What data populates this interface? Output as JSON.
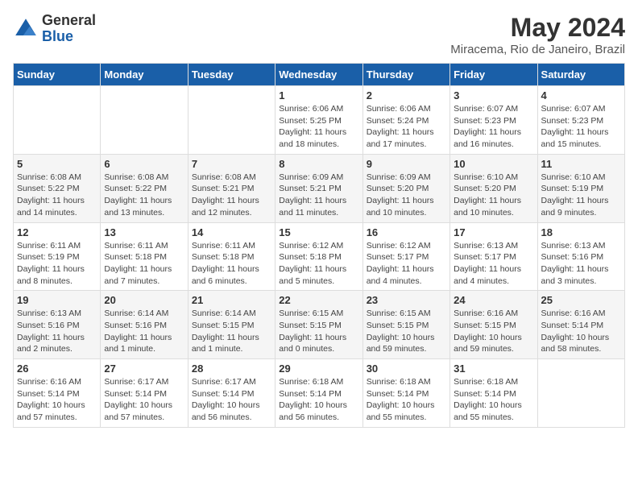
{
  "logo": {
    "general": "General",
    "blue": "Blue"
  },
  "title": {
    "month_year": "May 2024",
    "location": "Miracema, Rio de Janeiro, Brazil"
  },
  "days_of_week": [
    "Sunday",
    "Monday",
    "Tuesday",
    "Wednesday",
    "Thursday",
    "Friday",
    "Saturday"
  ],
  "weeks": [
    [
      {
        "day": "",
        "info": ""
      },
      {
        "day": "",
        "info": ""
      },
      {
        "day": "",
        "info": ""
      },
      {
        "day": "1",
        "info": "Sunrise: 6:06 AM\nSunset: 5:25 PM\nDaylight: 11 hours and 18 minutes."
      },
      {
        "day": "2",
        "info": "Sunrise: 6:06 AM\nSunset: 5:24 PM\nDaylight: 11 hours and 17 minutes."
      },
      {
        "day": "3",
        "info": "Sunrise: 6:07 AM\nSunset: 5:23 PM\nDaylight: 11 hours and 16 minutes."
      },
      {
        "day": "4",
        "info": "Sunrise: 6:07 AM\nSunset: 5:23 PM\nDaylight: 11 hours and 15 minutes."
      }
    ],
    [
      {
        "day": "5",
        "info": "Sunrise: 6:08 AM\nSunset: 5:22 PM\nDaylight: 11 hours and 14 minutes."
      },
      {
        "day": "6",
        "info": "Sunrise: 6:08 AM\nSunset: 5:22 PM\nDaylight: 11 hours and 13 minutes."
      },
      {
        "day": "7",
        "info": "Sunrise: 6:08 AM\nSunset: 5:21 PM\nDaylight: 11 hours and 12 minutes."
      },
      {
        "day": "8",
        "info": "Sunrise: 6:09 AM\nSunset: 5:21 PM\nDaylight: 11 hours and 11 minutes."
      },
      {
        "day": "9",
        "info": "Sunrise: 6:09 AM\nSunset: 5:20 PM\nDaylight: 11 hours and 10 minutes."
      },
      {
        "day": "10",
        "info": "Sunrise: 6:10 AM\nSunset: 5:20 PM\nDaylight: 11 hours and 10 minutes."
      },
      {
        "day": "11",
        "info": "Sunrise: 6:10 AM\nSunset: 5:19 PM\nDaylight: 11 hours and 9 minutes."
      }
    ],
    [
      {
        "day": "12",
        "info": "Sunrise: 6:11 AM\nSunset: 5:19 PM\nDaylight: 11 hours and 8 minutes."
      },
      {
        "day": "13",
        "info": "Sunrise: 6:11 AM\nSunset: 5:18 PM\nDaylight: 11 hours and 7 minutes."
      },
      {
        "day": "14",
        "info": "Sunrise: 6:11 AM\nSunset: 5:18 PM\nDaylight: 11 hours and 6 minutes."
      },
      {
        "day": "15",
        "info": "Sunrise: 6:12 AM\nSunset: 5:18 PM\nDaylight: 11 hours and 5 minutes."
      },
      {
        "day": "16",
        "info": "Sunrise: 6:12 AM\nSunset: 5:17 PM\nDaylight: 11 hours and 4 minutes."
      },
      {
        "day": "17",
        "info": "Sunrise: 6:13 AM\nSunset: 5:17 PM\nDaylight: 11 hours and 4 minutes."
      },
      {
        "day": "18",
        "info": "Sunrise: 6:13 AM\nSunset: 5:16 PM\nDaylight: 11 hours and 3 minutes."
      }
    ],
    [
      {
        "day": "19",
        "info": "Sunrise: 6:13 AM\nSunset: 5:16 PM\nDaylight: 11 hours and 2 minutes."
      },
      {
        "day": "20",
        "info": "Sunrise: 6:14 AM\nSunset: 5:16 PM\nDaylight: 11 hours and 1 minute."
      },
      {
        "day": "21",
        "info": "Sunrise: 6:14 AM\nSunset: 5:15 PM\nDaylight: 11 hours and 1 minute."
      },
      {
        "day": "22",
        "info": "Sunrise: 6:15 AM\nSunset: 5:15 PM\nDaylight: 11 hours and 0 minutes."
      },
      {
        "day": "23",
        "info": "Sunrise: 6:15 AM\nSunset: 5:15 PM\nDaylight: 10 hours and 59 minutes."
      },
      {
        "day": "24",
        "info": "Sunrise: 6:16 AM\nSunset: 5:15 PM\nDaylight: 10 hours and 59 minutes."
      },
      {
        "day": "25",
        "info": "Sunrise: 6:16 AM\nSunset: 5:14 PM\nDaylight: 10 hours and 58 minutes."
      }
    ],
    [
      {
        "day": "26",
        "info": "Sunrise: 6:16 AM\nSunset: 5:14 PM\nDaylight: 10 hours and 57 minutes."
      },
      {
        "day": "27",
        "info": "Sunrise: 6:17 AM\nSunset: 5:14 PM\nDaylight: 10 hours and 57 minutes."
      },
      {
        "day": "28",
        "info": "Sunrise: 6:17 AM\nSunset: 5:14 PM\nDaylight: 10 hours and 56 minutes."
      },
      {
        "day": "29",
        "info": "Sunrise: 6:18 AM\nSunset: 5:14 PM\nDaylight: 10 hours and 56 minutes."
      },
      {
        "day": "30",
        "info": "Sunrise: 6:18 AM\nSunset: 5:14 PM\nDaylight: 10 hours and 55 minutes."
      },
      {
        "day": "31",
        "info": "Sunrise: 6:18 AM\nSunset: 5:14 PM\nDaylight: 10 hours and 55 minutes."
      },
      {
        "day": "",
        "info": ""
      }
    ]
  ]
}
